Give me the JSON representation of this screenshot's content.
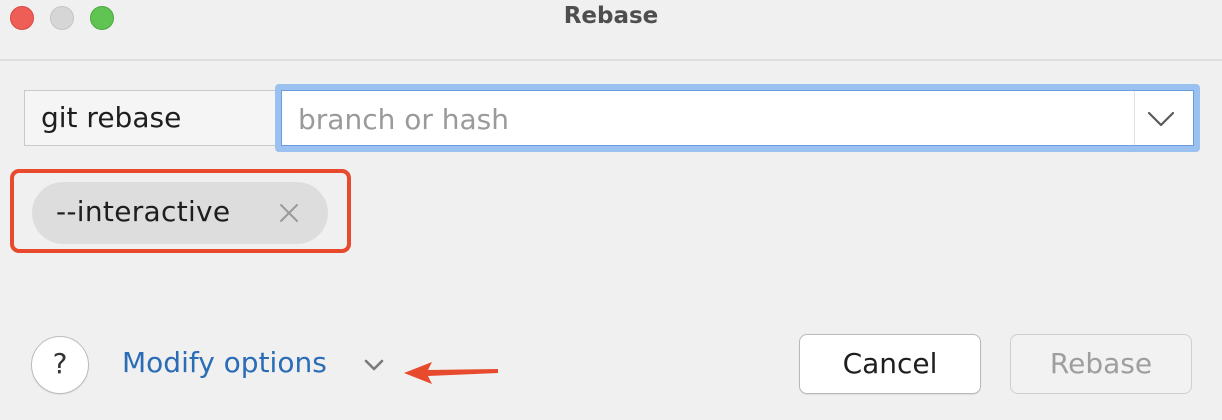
{
  "window": {
    "title": "Rebase",
    "controls": [
      "close",
      "minimize",
      "zoom"
    ]
  },
  "command": {
    "label": "git rebase",
    "branch_placeholder": "branch or hash",
    "branch_value": ""
  },
  "options": {
    "chips": [
      {
        "label": "--interactive",
        "remove_icon": "close-icon"
      }
    ]
  },
  "footer": {
    "help_label": "?",
    "modify_options_label": "Modify options",
    "cancel_label": "Cancel",
    "rebase_label": "Rebase",
    "rebase_enabled": false
  },
  "colors": {
    "link": "#2a6cb6",
    "focus_ring": "#9ac1f0",
    "annotation": "#e84a2e",
    "chip_bg": "#dddddd"
  }
}
